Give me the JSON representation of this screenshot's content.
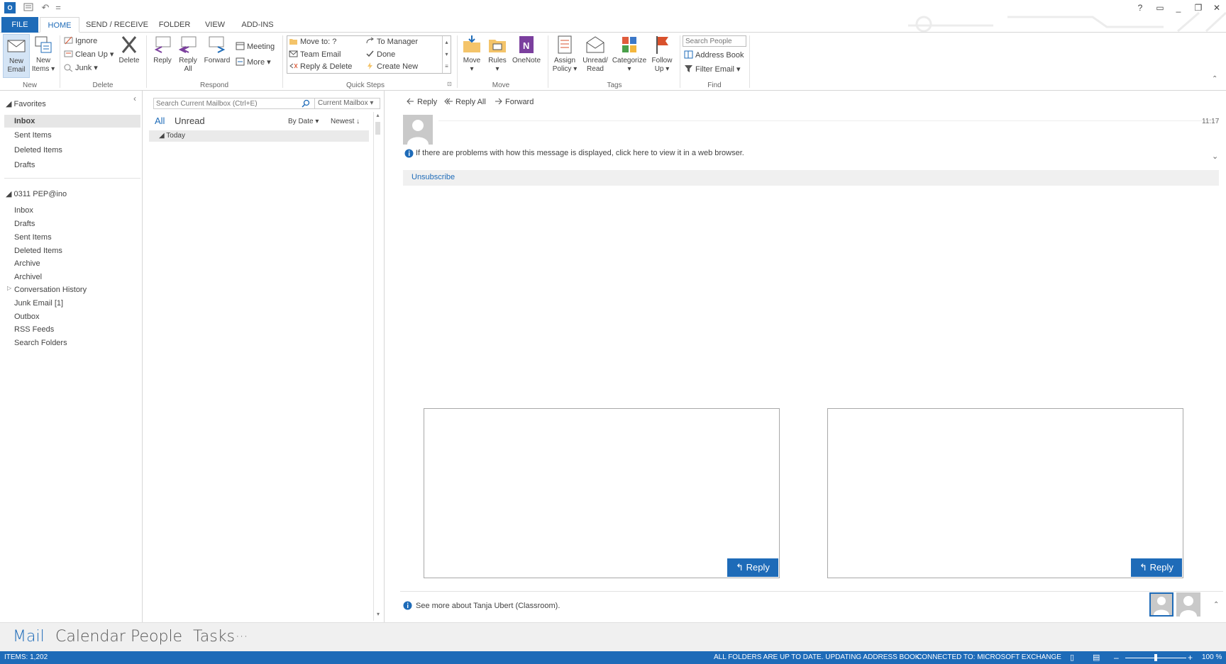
{
  "quick_access": {
    "undo_glyph": "↶",
    "customize_glyph": "="
  },
  "window_controls": {
    "help": "?",
    "ribbon_display": "▭",
    "minimize": "_",
    "restore": "❐",
    "close": "✕"
  },
  "tabs": [
    {
      "label": "FILE"
    },
    {
      "label": "HOME"
    },
    {
      "label": "SEND / RECEIVE"
    },
    {
      "label": "FOLDER"
    },
    {
      "label": "VIEW"
    },
    {
      "label": "ADD-INS"
    }
  ],
  "ribbon": {
    "new": {
      "new_email": "New\nEmail",
      "new_items": "New\nItems ▾",
      "label": "New"
    },
    "delete": {
      "ignore": "Ignore",
      "clean_up": "Clean Up ▾",
      "junk": "Junk ▾",
      "delete": "Delete",
      "label": "Delete"
    },
    "respond": {
      "reply": "Reply",
      "reply_all": "Reply\nAll",
      "forward": "Forward",
      "meeting": "Meeting",
      "more": "More ▾",
      "label": "Respond"
    },
    "quick_steps": {
      "move_to": "Move to: ?",
      "to_manager": "To Manager",
      "team_email": "Team Email",
      "done": "Done",
      "reply_delete": "Reply & Delete",
      "create_new": "Create New",
      "label": "Quick Steps"
    },
    "move": {
      "move": "Move\n▾",
      "rules": "Rules\n▾",
      "onenote": "OneNote",
      "label": "Move"
    },
    "tags": {
      "assign_policy": "Assign\nPolicy ▾",
      "unread_read": "Unread/\nRead",
      "categorize": "Categorize\n▾",
      "follow_up": "Follow\nUp ▾",
      "label": "Tags"
    },
    "find": {
      "search_people_placeholder": "Search People",
      "address_book": "Address Book",
      "filter_email": "Filter Email ▾",
      "label": "Find"
    }
  },
  "nav": {
    "favorites_header": "◢ Favorites",
    "favorites": [
      "Inbox",
      "Sent Items",
      "Deleted Items",
      "Drafts"
    ],
    "account_header": "◢ 0311 PEP@ino",
    "folders": [
      "Inbox",
      "Drafts",
      "Sent Items",
      "Deleted Items",
      "Archive",
      "Archivel",
      "Conversation History",
      "Junk Email [1]",
      "Outbox",
      "RSS Feeds",
      "Search Folders"
    ],
    "collapse_glyph": "‹"
  },
  "msglist": {
    "search_placeholder": "Search Current Mailbox (Ctrl+E)",
    "scope": "Current Mailbox ▾",
    "filter_all": "All",
    "filter_unread": "Unread",
    "sort_by": "By Date ▾",
    "sort_order": "Newest ↓",
    "group_today": "◢ Today"
  },
  "reading": {
    "reply": "Reply",
    "reply_all": "Reply All",
    "forward": "Forward",
    "time": "11:17",
    "info_notice": "If there are problems with how this message is displayed, click here to view it in a web browser.",
    "unsubscribe": "Unsubscribe",
    "card_reply_1": "↰ Reply",
    "card_reply_2": "↰ Reply",
    "people_pane": "See more about Tanja Ubert (Classroom)."
  },
  "bottom_nav": {
    "mail": "Mail",
    "calendar": "Calendar",
    "people": "People",
    "tasks": "Tasks",
    "more": "···"
  },
  "status": {
    "items": "ITEMS: 1,202",
    "sync": "ALL FOLDERS ARE UP TO DATE.  UPDATING ADDRESS BOOK.",
    "connection": "CONNECTED TO: MICROSOFT EXCHANGE",
    "zoom": "100 %"
  },
  "colors": {
    "accent": "#1e6bb8",
    "status_bar": "#1e6bb8",
    "onenote": "#7b3f9e",
    "flag": "#d9512c"
  }
}
